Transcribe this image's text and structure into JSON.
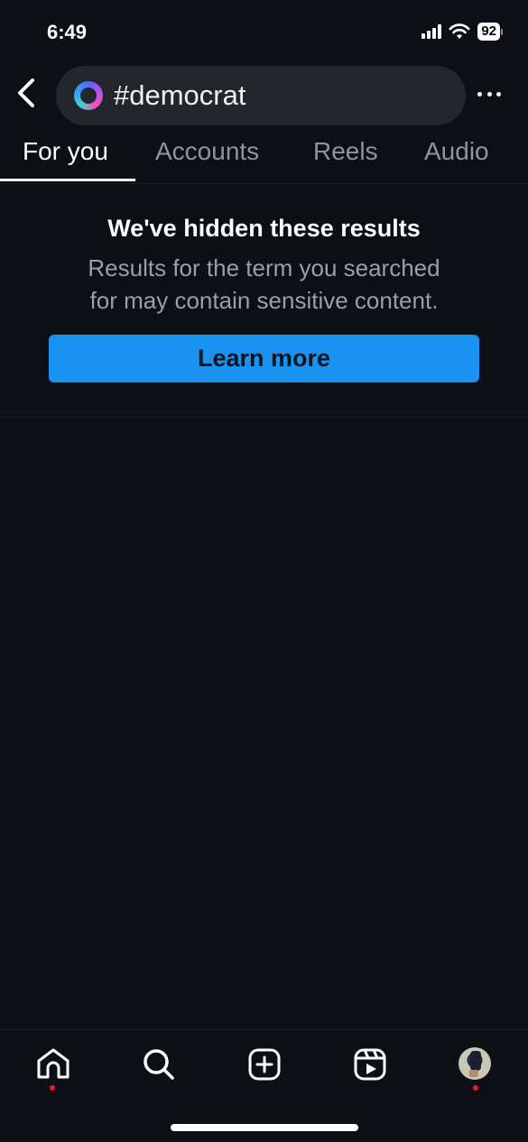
{
  "status_bar": {
    "time": "6:49",
    "battery": "92",
    "icons": [
      "signal-icon",
      "wifi-icon",
      "battery-icon"
    ]
  },
  "search": {
    "back_icon": "chevron-left-icon",
    "query": "#democrat",
    "search_icon": "ring-icon",
    "more_icon": "more-horizontal-icon"
  },
  "tabs": [
    {
      "label": "For you",
      "active": true
    },
    {
      "label": "Accounts",
      "active": false
    },
    {
      "label": "Reels",
      "active": false
    },
    {
      "label": "Audio",
      "active": false
    }
  ],
  "notice": {
    "title": "We've hidden these results",
    "body_line1": "Results for the term you searched",
    "body_line2": "for may contain sensitive content.",
    "button_label": "Learn more"
  },
  "colors": {
    "background": "#0c0f14",
    "accent_button": "#1a93f0",
    "notification_dot": "#e81c2c",
    "inactive_tab": "#8e949d"
  },
  "bottom_nav": {
    "items": [
      {
        "name": "home",
        "icon": "home-icon",
        "has_dot": true
      },
      {
        "name": "search",
        "icon": "search-icon",
        "has_dot": false
      },
      {
        "name": "create",
        "icon": "plus-square-icon",
        "has_dot": false
      },
      {
        "name": "reels",
        "icon": "reels-icon",
        "has_dot": false
      },
      {
        "name": "profile",
        "icon": "avatar",
        "has_dot": true
      }
    ]
  }
}
